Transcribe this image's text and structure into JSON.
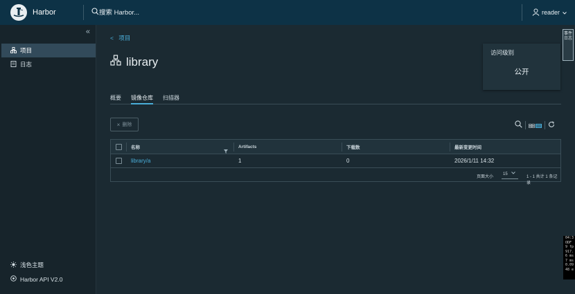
{
  "header": {
    "app_name": "Harbor",
    "search_placeholder": "搜索 Harbor...",
    "user_name": "reader",
    "brand_color": "#0d3246"
  },
  "sidebar": {
    "collapse_glyph": "«",
    "items": [
      {
        "label": "项目",
        "icon": "projects-icon",
        "active": true
      },
      {
        "label": "日志",
        "icon": "logs-icon",
        "active": false
      }
    ],
    "theme_label": "浅色主题",
    "api_label": "Harbor API V2.0"
  },
  "breadcrumb": {
    "back_glyph": "<",
    "label": "项目"
  },
  "project": {
    "name": "library"
  },
  "access_card": {
    "label": "访问级别",
    "value": "公开"
  },
  "side_tab": {
    "label": "事件日志"
  },
  "tabs": [
    {
      "label": "概要",
      "active": false
    },
    {
      "label": "镜像仓库",
      "active": true
    },
    {
      "label": "扫描器",
      "active": false
    }
  ],
  "toolbar": {
    "delete_label": "删除"
  },
  "table": {
    "columns": [
      "名称",
      "Artifacts",
      "下载数",
      "最新变更时间"
    ],
    "rows": [
      {
        "name": "library/a",
        "artifacts": "1",
        "pulls": "0",
        "updated": "2026/1/11 14:32"
      }
    ],
    "footer": {
      "page_size_label": "页面大小",
      "page_size": "15",
      "page_info": "1 - 1 共计 1 条记录"
    }
  },
  "debug_overlay": {
    "lines": [
      "04:3",
      "ODF",
      "9 fp",
      "917.",
      "6 ms",
      "7 ms",
      "0.09",
      "48 e"
    ]
  },
  "accent_color": "#4aaed9"
}
